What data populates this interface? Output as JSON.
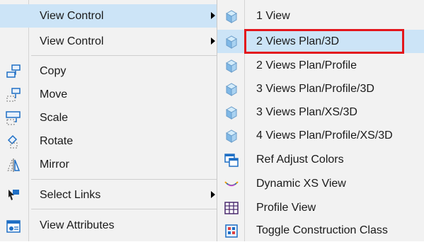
{
  "main_menu": {
    "items": [
      {
        "label": "View Control",
        "icon": "none",
        "submenu": true,
        "highlighted": true
      },
      {
        "label": "View Control",
        "icon": "none",
        "submenu": true,
        "highlighted": false
      },
      {
        "label": "Copy",
        "icon": "copy-icon",
        "submenu": false
      },
      {
        "label": "Move",
        "icon": "move-icon",
        "submenu": false
      },
      {
        "label": "Scale",
        "icon": "scale-icon",
        "submenu": false
      },
      {
        "label": "Rotate",
        "icon": "rotate-icon",
        "submenu": false
      },
      {
        "label": "Mirror",
        "icon": "mirror-icon",
        "submenu": false
      },
      {
        "label": "Select Links",
        "icon": "select-links-icon",
        "submenu": true
      },
      {
        "label": "View Attributes",
        "icon": "view-attributes-icon",
        "submenu": false
      }
    ]
  },
  "sub_menu": {
    "items": [
      {
        "label": "1 View",
        "icon": "view-cube-icon"
      },
      {
        "label": "2 Views Plan/3D",
        "icon": "view-cube-icon",
        "hover": true,
        "outlined": true
      },
      {
        "label": "2 Views Plan/Profile",
        "icon": "view-cube-icon"
      },
      {
        "label": "3 Views Plan/Profile/3D",
        "icon": "view-cube-icon"
      },
      {
        "label": "3 Views Plan/XS/3D",
        "icon": "view-cube-icon"
      },
      {
        "label": "4 Views Plan/Profile/XS/3D",
        "icon": "view-cube-icon"
      },
      {
        "label": "Ref Adjust Colors",
        "icon": "ref-adjust-colors-icon"
      },
      {
        "label": "Dynamic XS View",
        "icon": "dynamic-xs-view-icon"
      },
      {
        "label": "Profile View",
        "icon": "profile-view-icon"
      },
      {
        "label": "Toggle Construction Class",
        "icon": "toggle-construction-class-icon"
      }
    ]
  },
  "colors": {
    "hover_highlight": "#cce4f7",
    "annotation_outline": "#e3161c",
    "menu_background": "#f2f2f2"
  }
}
